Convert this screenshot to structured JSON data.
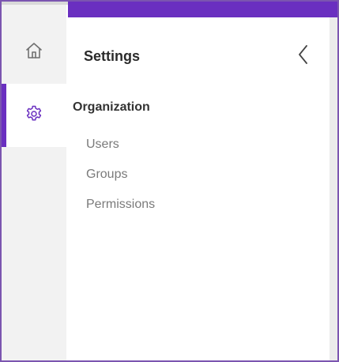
{
  "panel": {
    "title": "Settings"
  },
  "rail": {
    "items": [
      {
        "name": "home",
        "icon": "home-icon"
      },
      {
        "name": "settings",
        "icon": "gear-icon",
        "active": true
      }
    ]
  },
  "section": {
    "heading": "Organization",
    "items": [
      {
        "label": "Users"
      },
      {
        "label": "Groups"
      },
      {
        "label": "Permissions"
      }
    ]
  },
  "colors": {
    "accent": "#6a2fc0",
    "border": "#7b55b0",
    "rail_bg": "#f2f2f2"
  }
}
